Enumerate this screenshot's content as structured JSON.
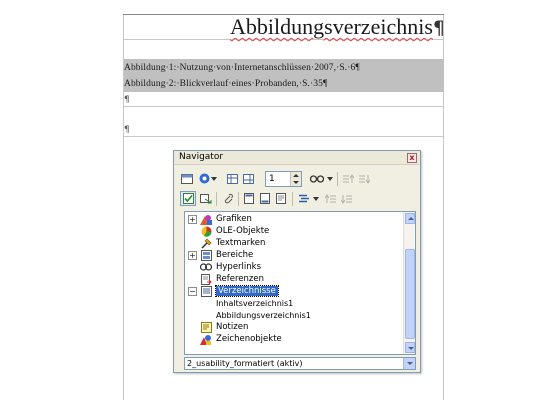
{
  "document": {
    "heading": "Abbildungsverzeichnis",
    "heading_mark": "¶",
    "entries": [
      "Abbildung·1:·Nutzung·von·Internetanschlüssen·2007,·S.·6¶",
      "Abbildung·2:·Blickverlauf·eines·Probanden,·S.·35¶"
    ],
    "empty_para_1": "¶",
    "empty_para_2": "¶"
  },
  "navigator": {
    "title": "Navigator",
    "close_glyph": "x",
    "page_number": "1",
    "tree": [
      {
        "label": "Grafiken",
        "expander": "+",
        "icon": "graphics-icon"
      },
      {
        "label": "OLE-Objekte",
        "expander": "",
        "icon": "ole-object-icon"
      },
      {
        "label": "Textmarken",
        "expander": "",
        "icon": "bookmark-icon"
      },
      {
        "label": "Bereiche",
        "expander": "+",
        "icon": "sections-icon"
      },
      {
        "label": "Hyperlinks",
        "expander": "",
        "icon": "hyperlink-icon"
      },
      {
        "label": "Referenzen",
        "expander": "",
        "icon": "references-icon"
      },
      {
        "label": "Verzeichnisse",
        "expander": "−",
        "icon": "indexes-icon",
        "selected": true
      },
      {
        "label": "Inhaltsverzeichnis1",
        "child": true
      },
      {
        "label": "Abbildungsverzeichnis1",
        "child": true
      },
      {
        "label": "Notizen",
        "expander": "",
        "icon": "notes-icon"
      },
      {
        "label": "Zeichenobjekte",
        "expander": "",
        "icon": "drawing-objects-icon"
      }
    ],
    "document_select": "2_usability_formatiert (aktiv)"
  }
}
